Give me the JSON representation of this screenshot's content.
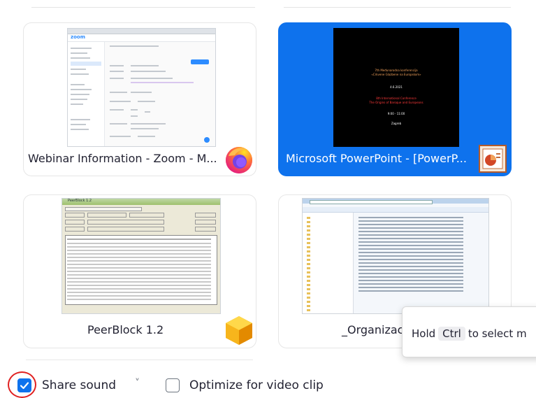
{
  "cards": [
    {
      "label": "Webinar Information - Zoom - M...",
      "icon": "firefox-icon",
      "selected": false
    },
    {
      "label": "Microsoft PowerPoint - [PowerP...",
      "icon": "powerpoint-icon",
      "selected": true
    },
    {
      "label": "PeerBlock 1.2",
      "icon": "peerblock-icon",
      "selected": false
    },
    {
      "label": "_Organizac",
      "icon": "folder-icon",
      "selected": false
    }
  ],
  "thumbnails": {
    "zoom_logo": "zoom",
    "ppt_lines": [
      "7th Međunarodna konferencija",
      "«Crkvene Glazbene na Europskom»",
      "4.6.2021",
      "8th International Conference",
      "The Origins of Baroque and Europeans",
      "9:00 - 11:00",
      "Zagreb"
    ],
    "peerblock_title": "PeerBlock 1.2"
  },
  "tooltip": {
    "prefix": "Hold",
    "key": "Ctrl",
    "suffix": "to select m"
  },
  "options": {
    "share_sound": {
      "label": "Share sound",
      "checked": true
    },
    "share_sound_dropdown": "˅",
    "optimize_video": {
      "label": "Optimize for video clip",
      "checked": false
    }
  },
  "colors": {
    "accent": "#0e72ed",
    "highlight_ring": "#e02020"
  }
}
